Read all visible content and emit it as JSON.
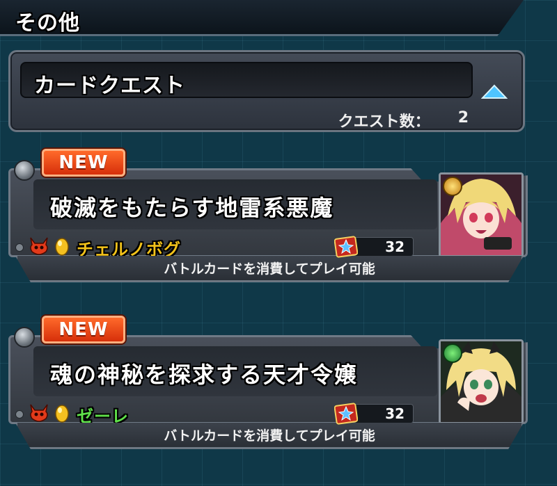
{
  "section": {
    "title": "その他"
  },
  "category": {
    "name": "カードクエスト",
    "count_label": "クエスト数：",
    "count_value": "2"
  },
  "quests": [
    {
      "badge": "NEW",
      "title": "破滅をもたらす地雷系悪魔",
      "boss_name": "チェルノボグ",
      "boss_name_color": "#f2c21a",
      "card_cost": "32",
      "footer": "バトルカードを消費してプレイ可能",
      "element": "light-icon",
      "element_color": "#e0a020"
    },
    {
      "badge": "NEW",
      "title": "魂の神秘を探求する天才令嬢",
      "boss_name": "ゼーレ",
      "boss_name_color": "#5fe04a",
      "card_cost": "32",
      "footer": "バトルカードを消費してプレイ可能",
      "element": "wood-icon",
      "element_color": "#2fa64a"
    }
  ]
}
